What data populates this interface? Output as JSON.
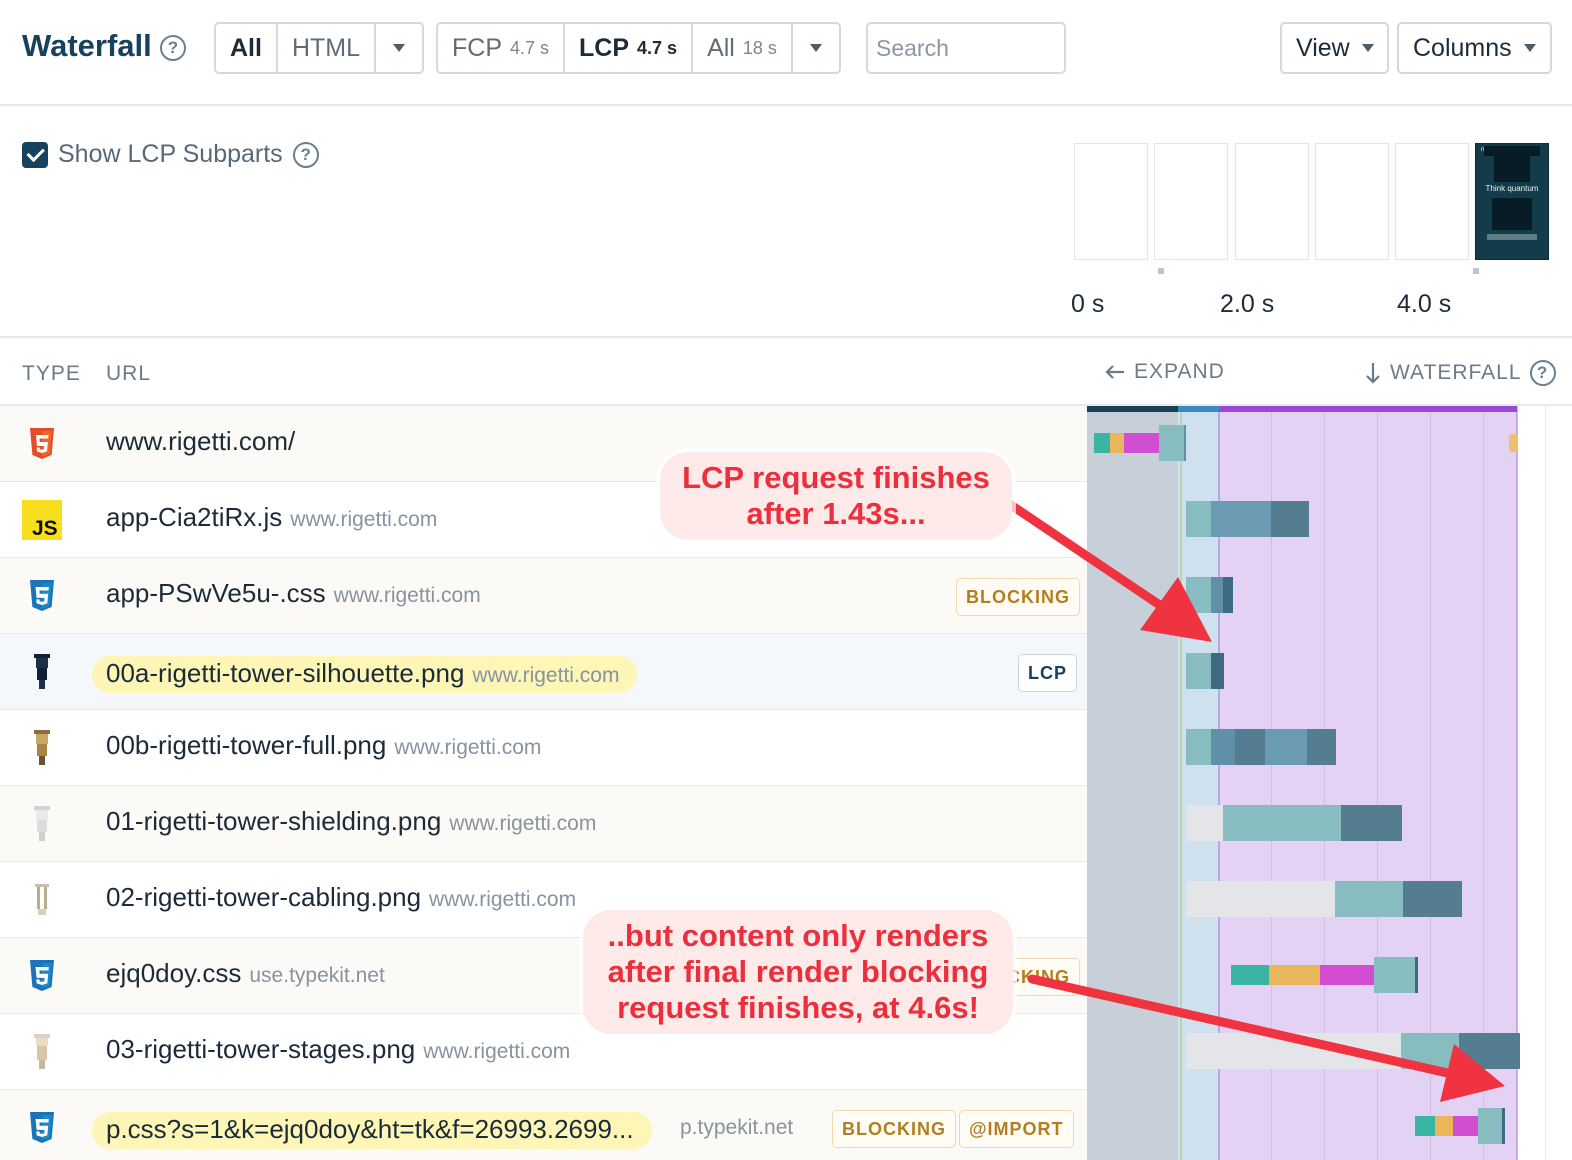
{
  "toolbar": {
    "title": "Waterfall",
    "help_glyph": "?",
    "type_filter": {
      "all": "All",
      "html": "HTML"
    },
    "metric_filter": {
      "fcp_label": "FCP",
      "fcp_value": "4.7 s",
      "lcp_label": "LCP",
      "lcp_value": "4.7 s",
      "all_label": "All",
      "all_value": "18 s"
    },
    "search_placeholder": "Search",
    "view_label": "View",
    "columns_label": "Columns"
  },
  "subparts": {
    "label": "Show LCP Subparts",
    "checked": true
  },
  "filmstrip": {
    "frames": 6,
    "last_frame_caption": "Think quantum",
    "last_frame_logo": "rigetti",
    "time_labels": [
      "0 s",
      "2.0 s",
      "4.0 s"
    ]
  },
  "table": {
    "headers": {
      "type": "TYPE",
      "url": "URL",
      "expand": "EXPAND",
      "waterfall": "WATERFALL"
    },
    "rows": [
      {
        "type": "html",
        "name": "www.rigetti.com/",
        "domain": "",
        "badges": []
      },
      {
        "type": "js",
        "name": "app-Cia2tiRx.js",
        "domain": "www.rigetti.com",
        "badges": []
      },
      {
        "type": "css",
        "name": "app-PSwVe5u-.css",
        "domain": "www.rigetti.com",
        "badges": [
          "BLOCKING"
        ]
      },
      {
        "type": "image",
        "name": "00a-rigetti-tower-silhouette.png",
        "domain": "www.rigetti.com",
        "badges": [
          "LCP"
        ]
      },
      {
        "type": "image",
        "name": "00b-rigetti-tower-full.png",
        "domain": "www.rigetti.com",
        "badges": []
      },
      {
        "type": "image",
        "name": "01-rigetti-tower-shielding.png",
        "domain": "www.rigetti.com",
        "badges": []
      },
      {
        "type": "image",
        "name": "02-rigetti-tower-cabling.png",
        "domain": "www.rigetti.com",
        "badges": []
      },
      {
        "type": "css",
        "name": "ejq0doy.css",
        "domain": "use.typekit.net",
        "badges": [
          "BLOCKING"
        ]
      },
      {
        "type": "image",
        "name": "03-rigetti-tower-stages.png",
        "domain": "www.rigetti.com",
        "badges": []
      },
      {
        "type": "css",
        "name": "p.css?s=1&k=ejq0doy&ht=tk&f=26993.2699...",
        "domain": "p.typekit.net",
        "badges": [
          "BLOCKING",
          "@IMPORT"
        ]
      }
    ]
  },
  "annotations": {
    "top": [
      "LCP request finishes",
      "after 1.43s..."
    ],
    "bottom": [
      "..but content only renders",
      "after final render blocking",
      "request finishes, at 4.6s!"
    ]
  },
  "colors": {
    "brand": "#16425e",
    "annotation": "#ec2f3c",
    "render_phase": "#e4d2f5",
    "blocking_phase": "#c7d0d8",
    "load_phase": "#cfe1ee",
    "bar_wait": "#87bcc1",
    "bar_download": "#5f8fa9",
    "dns": "#3ab5a4",
    "connect": "#e9b75a",
    "ssl": "#d04ecf"
  }
}
